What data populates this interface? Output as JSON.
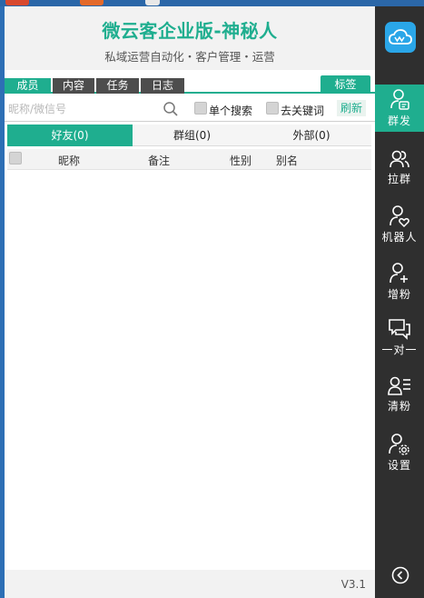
{
  "header": {
    "title": "微云客企业版-神秘人",
    "subtitle": "私域运营自动化・客户管理・运营"
  },
  "tabs": [
    {
      "label": "成员",
      "active": true
    },
    {
      "label": "内容",
      "active": false
    },
    {
      "label": "任务",
      "active": false
    },
    {
      "label": "日志",
      "active": false
    }
  ],
  "tag_button": "标签",
  "search": {
    "placeholder": "昵称/微信号",
    "value": "",
    "single_search_label": "单个搜索",
    "remove_keyword_label": "去关键词",
    "refresh_label": "刷新"
  },
  "segments": [
    {
      "label": "好友(0)",
      "active": true
    },
    {
      "label": "群组(0)",
      "active": false
    },
    {
      "label": "外部(0)",
      "active": false
    }
  ],
  "table": {
    "columns": [
      "昵称",
      "备注",
      "性别",
      "别名"
    ],
    "rows": []
  },
  "version": "V3.1",
  "sidebar": {
    "items": [
      {
        "label": "群发",
        "icon": "user-message-icon",
        "active": true
      },
      {
        "label": "拉群",
        "icon": "users-icon",
        "active": false
      },
      {
        "label": "机器人",
        "icon": "user-heart-icon",
        "active": false
      },
      {
        "label": "增粉",
        "icon": "user-plus-icon",
        "active": false
      },
      {
        "label": "一对一",
        "icon": "chat-bubbles-icon",
        "active": false
      },
      {
        "label": "清粉",
        "icon": "user-list-icon",
        "active": false
      },
      {
        "label": "设置",
        "icon": "user-gear-icon",
        "active": false
      }
    ]
  },
  "colors": {
    "accent": "#1fae8f",
    "sidebar_bg": "#2f2f2f",
    "tab_inactive": "#4d4d4d",
    "logo": "#2aa6e8"
  }
}
